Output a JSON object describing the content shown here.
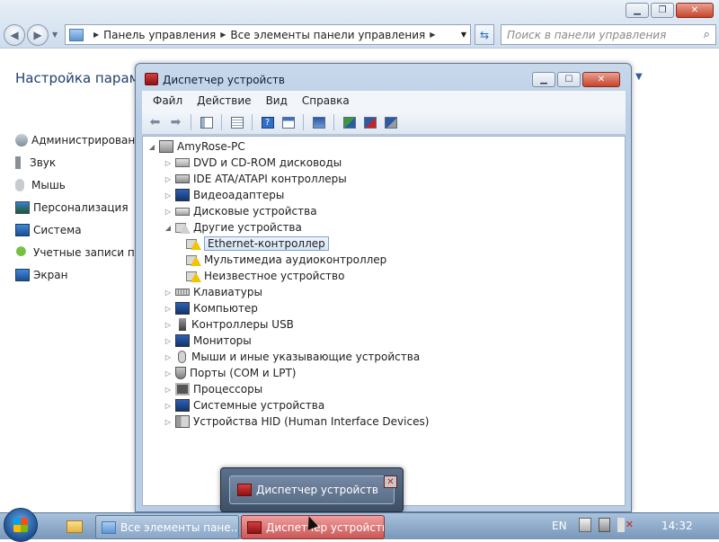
{
  "background_window": {
    "breadcrumb": [
      "Панель управления",
      "Все элементы панели управления"
    ],
    "search_placeholder": "Поиск в панели управления",
    "heading": "Настройка параме",
    "items": [
      {
        "label": "Администрирование",
        "icon": "admin-tools-icon"
      },
      {
        "label": "Звук",
        "icon": "speaker-icon"
      },
      {
        "label": "Мышь",
        "icon": "mouse-icon"
      },
      {
        "label": "Персонализация",
        "icon": "personalization-icon"
      },
      {
        "label": "Система",
        "icon": "system-icon"
      },
      {
        "label": "Учетные записи пол",
        "icon": "user-accounts-icon"
      },
      {
        "label": "Экран",
        "icon": "display-icon"
      }
    ]
  },
  "device_manager": {
    "title": "Диспетчер устройств",
    "menu": [
      "Файл",
      "Действие",
      "Вид",
      "Справка"
    ],
    "tree": {
      "root": "AmyRose-PC",
      "nodes": [
        {
          "label": "DVD и CD-ROM дисководы",
          "icon": "dvd-drive-icon"
        },
        {
          "label": "IDE ATA/ATAPI контроллеры",
          "icon": "ide-controller-icon"
        },
        {
          "label": "Видеоадаптеры",
          "icon": "display-adapter-icon"
        },
        {
          "label": "Дисковые устройства",
          "icon": "disk-drive-icon"
        },
        {
          "label": "Другие устройства",
          "icon": "other-devices-icon",
          "expanded": true,
          "children": [
            {
              "label": "Ethernet-контроллер",
              "selected": true
            },
            {
              "label": "Мультимедиа аудиоконтроллер"
            },
            {
              "label": "Неизвестное устройство"
            }
          ]
        },
        {
          "label": "Клавиатуры",
          "icon": "keyboard-icon"
        },
        {
          "label": "Компьютер",
          "icon": "computer-icon"
        },
        {
          "label": "Контроллеры USB",
          "icon": "usb-icon"
        },
        {
          "label": "Мониторы",
          "icon": "monitor-icon"
        },
        {
          "label": "Мыши и иные указывающие устройства",
          "icon": "mouse-icon"
        },
        {
          "label": "Порты (COM и LPT)",
          "icon": "port-icon"
        },
        {
          "label": "Процессоры",
          "icon": "processor-icon"
        },
        {
          "label": "Системные устройства",
          "icon": "system-devices-icon"
        },
        {
          "label": "Устройства HID (Human Interface Devices)",
          "icon": "hid-icon"
        }
      ]
    }
  },
  "thumbnail": {
    "label": "Диспетчер устройств"
  },
  "taskbar": {
    "buttons": [
      {
        "label": "Все элементы пане..."
      },
      {
        "label": "Диспетчер устройств"
      }
    ],
    "language": "EN",
    "clock": "14:32"
  },
  "colors": {
    "accent": "#1e3f6e",
    "warning": "#f3c200",
    "device_manager_icon": "#c02a2a"
  }
}
